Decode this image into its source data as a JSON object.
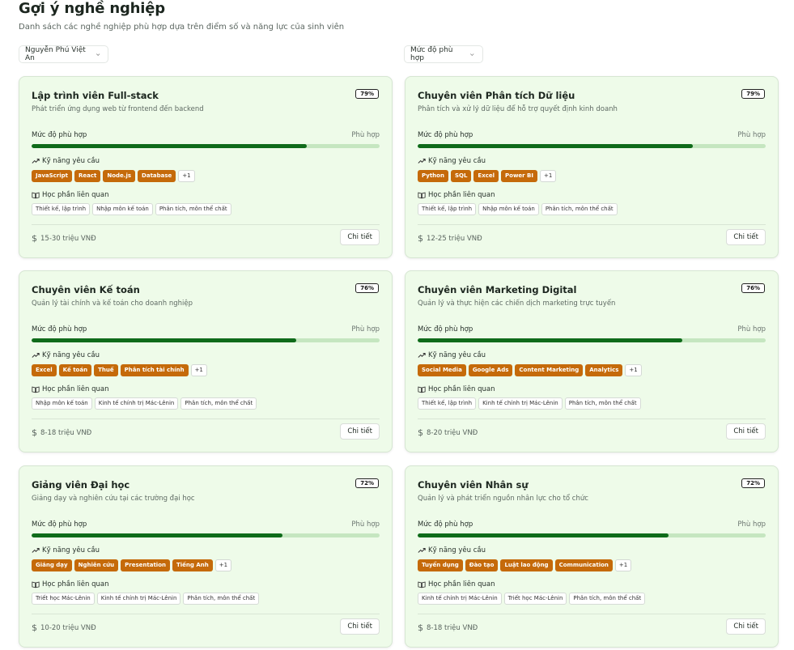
{
  "header": {
    "title": "Gợi ý nghề nghiệp",
    "subtitle": "Danh sách các nghề nghiệp phù hợp dựa trên điểm số và năng lực của sinh viên"
  },
  "filters": {
    "student": "Nguyễn Phú Việt An",
    "level": "Mức độ phù hợp"
  },
  "labels": {
    "fit_label": "Mức độ phù hợp",
    "skills_label": "Kỹ năng yêu cầu",
    "courses_label": "Học phần liên quan",
    "detail_button": "Chi tiết"
  },
  "colors": {
    "card_bg": "#eefbe9",
    "progress_fill": "#0f6b1a",
    "progress_track": "#c5e6c0",
    "skill_chip": "#c56a0a"
  },
  "careers": [
    {
      "title": "Lập trình viên Full-stack",
      "description": "Phát triển ứng dụng web từ frontend đến backend",
      "match": "79%",
      "match_value": 0.79,
      "fit_status": "Phù hợp",
      "skills": [
        "JavaScript",
        "React",
        "Node.js",
        "Database"
      ],
      "more": "+1",
      "courses": [
        "Thiết kế, lập trình",
        "Nhập môn kế toán",
        "Phân tích, môn thể chất"
      ],
      "salary": "15-30 triệu VNĐ"
    },
    {
      "title": "Chuyên viên Phân tích Dữ liệu",
      "description": "Phân tích và xử lý dữ liệu để hỗ trợ quyết định kinh doanh",
      "match": "79%",
      "match_value": 0.79,
      "fit_status": "Phù hợp",
      "skills": [
        "Python",
        "SQL",
        "Excel",
        "Power BI"
      ],
      "more": "+1",
      "courses": [
        "Thiết kế, lập trình",
        "Nhập môn kế toán",
        "Phân tích, môn thể chất"
      ],
      "salary": "12-25 triệu VNĐ"
    },
    {
      "title": "Chuyên viên Kế toán",
      "description": "Quản lý tài chính và kế toán cho doanh nghiệp",
      "match": "76%",
      "match_value": 0.76,
      "fit_status": "Phù hợp",
      "skills": [
        "Excel",
        "Kế toán",
        "Thuế",
        "Phân tích tài chính"
      ],
      "more": "+1",
      "courses": [
        "Nhập môn kế toán",
        "Kinh tế chính trị Mác-Lênin",
        "Phân tích, môn thể chất"
      ],
      "salary": "8-18 triệu VNĐ"
    },
    {
      "title": "Chuyên viên Marketing Digital",
      "description": "Quản lý và thực hiện các chiến dịch marketing trực tuyến",
      "match": "76%",
      "match_value": 0.76,
      "fit_status": "Phù hợp",
      "skills": [
        "Social Media",
        "Google Ads",
        "Content Marketing",
        "Analytics"
      ],
      "more": "+1",
      "courses": [
        "Thiết kế, lập trình",
        "Kinh tế chính trị Mác-Lênin",
        "Phân tích, môn thể chất"
      ],
      "salary": "8-20 triệu VNĐ"
    },
    {
      "title": "Giảng viên Đại học",
      "description": "Giảng dạy và nghiên cứu tại các trường đại học",
      "match": "72%",
      "match_value": 0.72,
      "fit_status": "Phù hợp",
      "skills": [
        "Giảng dạy",
        "Nghiên cứu",
        "Presentation",
        "Tiếng Anh"
      ],
      "more": "+1",
      "courses": [
        "Triết học Mác-Lênin",
        "Kinh tế chính trị Mác-Lênin",
        "Phân tích, môn thể chất"
      ],
      "salary": "10-20 triệu VNĐ"
    },
    {
      "title": "Chuyên viên Nhân sự",
      "description": "Quản lý và phát triển nguồn nhân lực cho tổ chức",
      "match": "72%",
      "match_value": 0.72,
      "fit_status": "Phù hợp",
      "skills": [
        "Tuyển dụng",
        "Đào tạo",
        "Luật lao động",
        "Communication"
      ],
      "more": "+1",
      "courses": [
        "Kinh tế chính trị Mác-Lênin",
        "Triết học Mác-Lênin",
        "Phân tích, môn thể chất"
      ],
      "salary": "8-18 triệu VNĐ"
    }
  ]
}
